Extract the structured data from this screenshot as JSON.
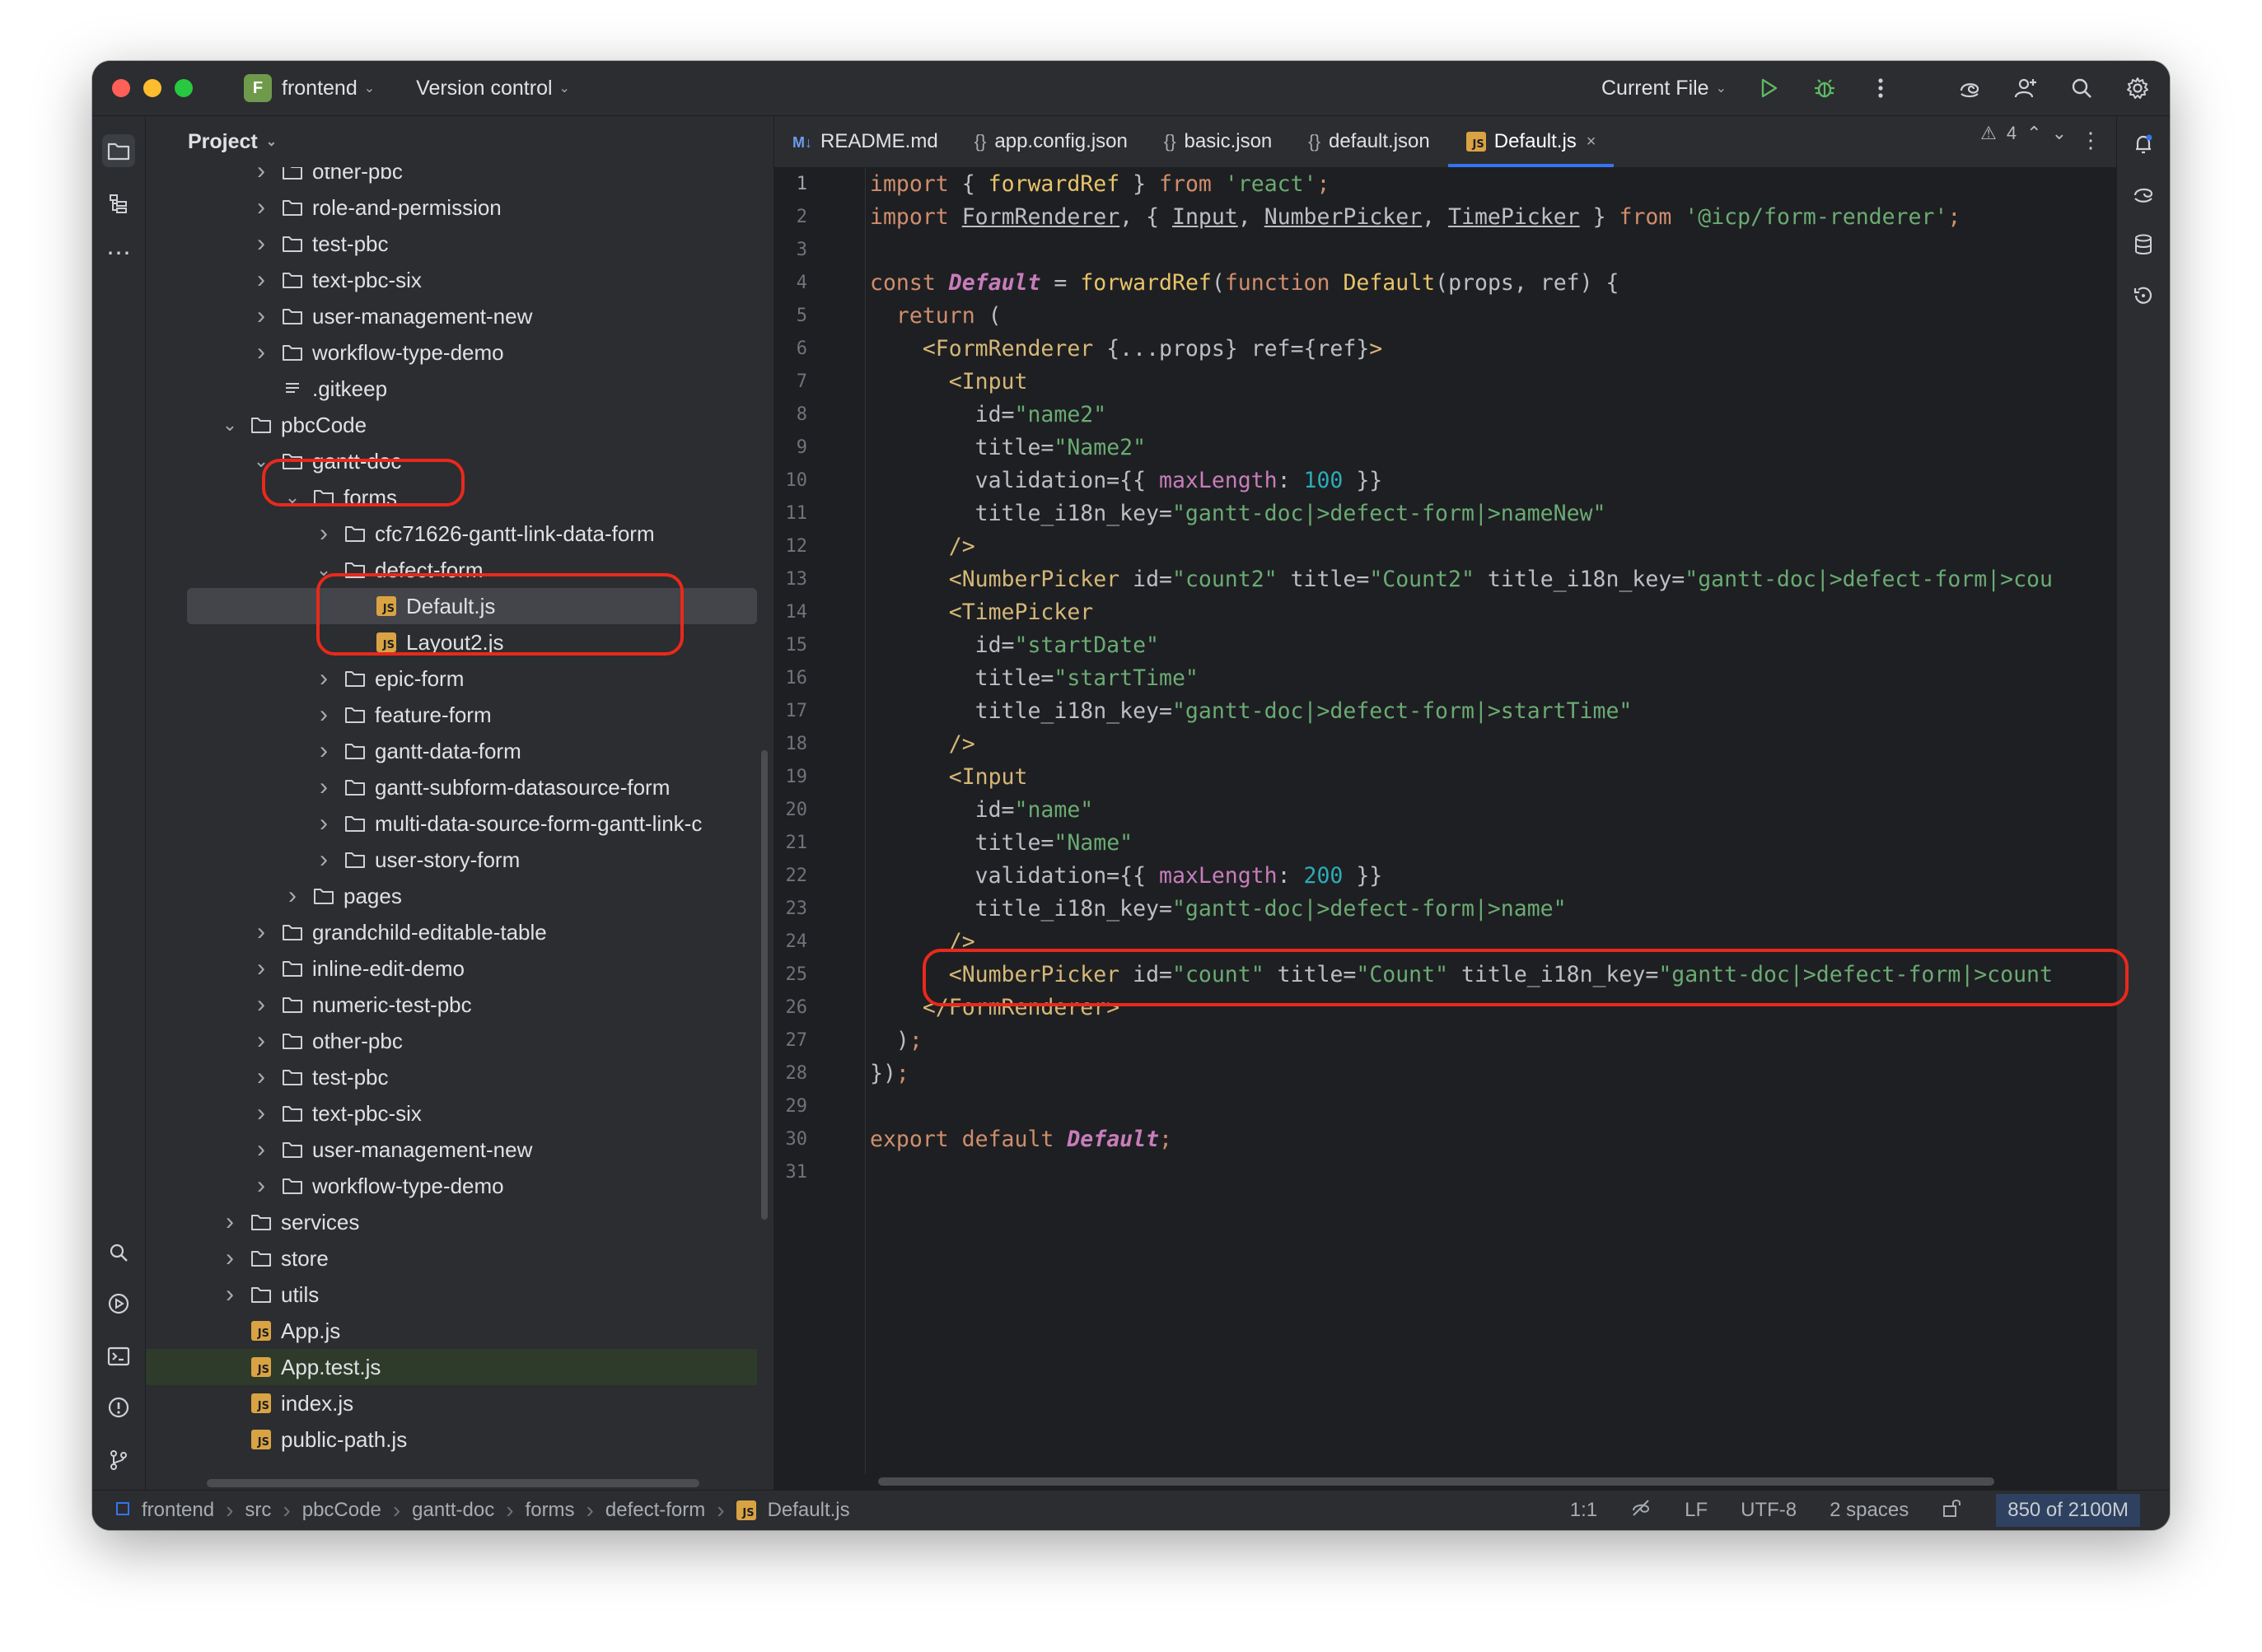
{
  "titlebar": {
    "project_badge": "F",
    "project_name": "frontend",
    "version_control": "Version control",
    "run_config": "Current File"
  },
  "project_panel": {
    "title": "Project",
    "tree": [
      {
        "label": "other-pbc",
        "type": "folder",
        "expanded": false
      },
      {
        "label": "role-and-permission",
        "type": "folder",
        "expanded": false
      },
      {
        "label": "test-pbc",
        "type": "folder",
        "expanded": false
      },
      {
        "label": "text-pbc-six",
        "type": "folder",
        "expanded": false
      },
      {
        "label": "user-management-new",
        "type": "folder",
        "expanded": false
      },
      {
        "label": "workflow-type-demo",
        "type": "folder",
        "expanded": false
      },
      {
        "label": ".gitkeep",
        "type": "file"
      },
      {
        "label": "pbcCode",
        "type": "folder",
        "expanded": true
      },
      {
        "label": "gantt-doc",
        "type": "folder",
        "expanded": true
      },
      {
        "label": "forms",
        "type": "folder",
        "expanded": true
      },
      {
        "label": "cfc71626-gantt-link-data-form",
        "type": "folder",
        "expanded": false
      },
      {
        "label": "defect-form",
        "type": "folder",
        "expanded": true
      },
      {
        "label": "Default.js",
        "type": "js",
        "selected": true
      },
      {
        "label": "Layout2.js",
        "type": "js"
      },
      {
        "label": "epic-form",
        "type": "folder",
        "expanded": false
      },
      {
        "label": "feature-form",
        "type": "folder",
        "expanded": false
      },
      {
        "label": "gantt-data-form",
        "type": "folder",
        "expanded": false
      },
      {
        "label": "gantt-subform-datasource-form",
        "type": "folder",
        "expanded": false
      },
      {
        "label": "multi-data-source-form-gantt-link-c",
        "type": "folder",
        "expanded": false
      },
      {
        "label": "user-story-form",
        "type": "folder",
        "expanded": false
      },
      {
        "label": "pages",
        "type": "folder",
        "expanded": false
      },
      {
        "label": "grandchild-editable-table",
        "type": "folder",
        "expanded": false
      },
      {
        "label": "inline-edit-demo",
        "type": "folder",
        "expanded": false
      },
      {
        "label": "numeric-test-pbc",
        "type": "folder",
        "expanded": false
      },
      {
        "label": "other-pbc",
        "type": "folder",
        "expanded": false
      },
      {
        "label": "test-pbc",
        "type": "folder",
        "expanded": false
      },
      {
        "label": "text-pbc-six",
        "type": "folder",
        "expanded": false
      },
      {
        "label": "user-management-new",
        "type": "folder",
        "expanded": false
      },
      {
        "label": "workflow-type-demo",
        "type": "folder",
        "expanded": false
      },
      {
        "label": "services",
        "type": "folder",
        "expanded": false
      },
      {
        "label": "store",
        "type": "folder",
        "expanded": false
      },
      {
        "label": "utils",
        "type": "folder",
        "expanded": false
      },
      {
        "label": "App.js",
        "type": "js"
      },
      {
        "label": "App.test.js",
        "type": "js",
        "modified": true
      },
      {
        "label": "index.js",
        "type": "js"
      },
      {
        "label": "public-path.js",
        "type": "js"
      }
    ]
  },
  "tabs": [
    {
      "label": "README.md",
      "icon": "markdown-icon"
    },
    {
      "label": "app.config.json",
      "icon": "json-icon"
    },
    {
      "label": "basic.json",
      "icon": "json-icon"
    },
    {
      "label": "default.json",
      "icon": "json-icon"
    },
    {
      "label": "Default.js",
      "icon": "js-icon",
      "active": true
    }
  ],
  "editor": {
    "warning_count": "4",
    "line_numbers": [
      "1",
      "2",
      "3",
      "4",
      "5",
      "6",
      "7",
      "8",
      "9",
      "10",
      "11",
      "12",
      "13",
      "14",
      "15",
      "16",
      "17",
      "18",
      "19",
      "20",
      "21",
      "22",
      "23",
      "24",
      "25",
      "26",
      "27",
      "28",
      "29",
      "30",
      "31"
    ]
  },
  "statusbar": {
    "breadcrumbs": [
      "frontend",
      "src",
      "pbcCode",
      "gantt-doc",
      "forms",
      "defect-form",
      "Default.js"
    ],
    "position": "1:1",
    "line_separator": "LF",
    "encoding": "UTF-8",
    "indent": "2 spaces",
    "memory": "850 of 2100M"
  },
  "colors": {
    "annotation": "#e8291c",
    "accent": "#3574f0",
    "background": "#1e1f22",
    "panel": "#2b2d30"
  }
}
